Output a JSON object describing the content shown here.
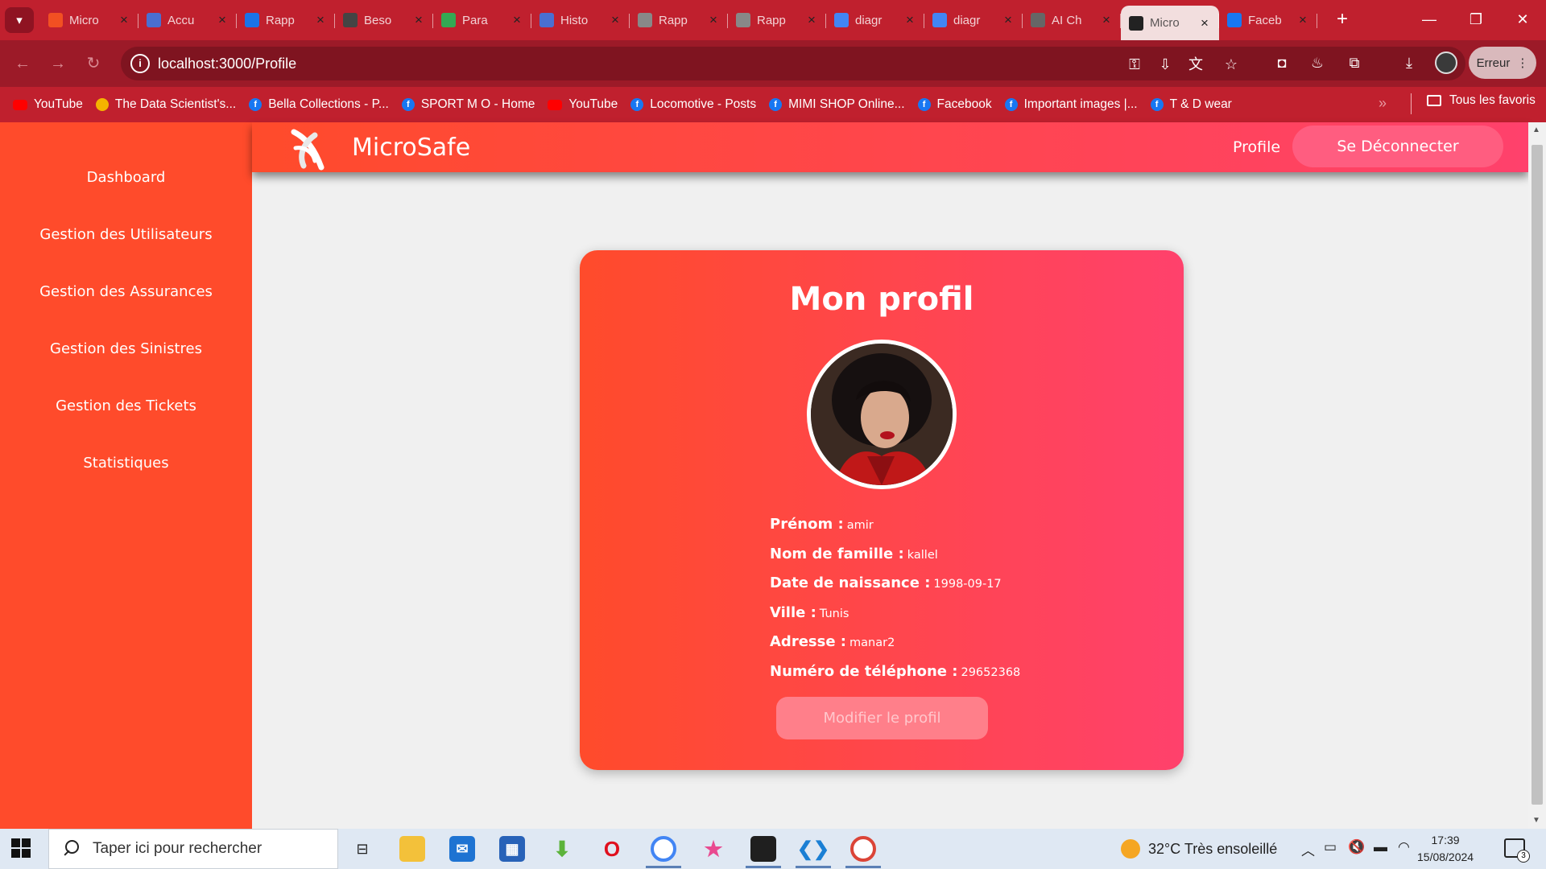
{
  "browser": {
    "tabs": [
      {
        "title": "Micro",
        "favicon": "microsoft-icon",
        "color": "#f25022",
        "active": false
      },
      {
        "title": "Accu",
        "favicon": "app-icon",
        "color": "#4a6fd1",
        "active": false
      },
      {
        "title": "Rapp",
        "favicon": "onedrive-icon",
        "color": "#1a73e8",
        "active": false
      },
      {
        "title": "Beso",
        "favicon": "openai-icon",
        "color": "#444444",
        "active": false
      },
      {
        "title": "Para",
        "favicon": "android-icon",
        "color": "#34a853",
        "active": false
      },
      {
        "title": "Histo",
        "favicon": "user-icon",
        "color": "#4a6fd1",
        "active": false
      },
      {
        "title": "Rapp",
        "favicon": "globe-icon",
        "color": "#888888",
        "active": false
      },
      {
        "title": "Rapp",
        "favicon": "globe-icon",
        "color": "#888888",
        "active": false
      },
      {
        "title": "diagr",
        "favicon": "google-icon",
        "color": "#4285f4",
        "active": false
      },
      {
        "title": "diagr",
        "favicon": "google-icon",
        "color": "#4285f4",
        "active": false
      },
      {
        "title": "AI Ch",
        "favicon": "ai-icon",
        "color": "#666666",
        "active": false
      },
      {
        "title": "Micro",
        "favicon": "react-icon",
        "color": "#222222",
        "active": true
      },
      {
        "title": "Faceb",
        "favicon": "facebook-icon",
        "color": "#1877f2",
        "active": false
      }
    ],
    "url": "localhost:3000/Profile",
    "profile_button": "Erreur",
    "bookmarks": [
      {
        "label": "YouTube",
        "icon": "youtube"
      },
      {
        "label": "The Data Scientist's...",
        "icon": "drive"
      },
      {
        "label": "Bella Collections - P...",
        "icon": "facebook"
      },
      {
        "label": "SPORT M O - Home",
        "icon": "facebook"
      },
      {
        "label": "YouTube",
        "icon": "youtube"
      },
      {
        "label": "Locomotive - Posts",
        "icon": "facebook"
      },
      {
        "label": "MIMI SHOP Online...",
        "icon": "facebook"
      },
      {
        "label": "Facebook",
        "icon": "facebook"
      },
      {
        "label": "Important images |...",
        "icon": "facebook"
      },
      {
        "label": "T & D wear",
        "icon": "facebook"
      }
    ],
    "bookmarks_overflow": "»",
    "all_bookmarks": "Tous les favoris"
  },
  "app": {
    "brand": "MicroSafe",
    "nav_profile": "Profile",
    "logout": "Se Déconnecter",
    "sidebar": [
      "Dashboard",
      "Gestion des Utilisateurs",
      "Gestion des Assurances",
      "Gestion des Sinistres",
      "Gestion des Tickets",
      "Statistiques"
    ],
    "profile": {
      "title": "Mon profil",
      "fields": [
        {
          "label": "Prénom :",
          "value": "amir"
        },
        {
          "label": "Nom de famille :",
          "value": "kallel"
        },
        {
          "label": "Date de naissance :",
          "value": "1998-09-17"
        },
        {
          "label": "Ville :",
          "value": "Tunis"
        },
        {
          "label": "Adresse :",
          "value": "manar2"
        },
        {
          "label": "Numéro de téléphone :",
          "value": "29652368"
        }
      ],
      "edit_button": "Modifier le profil"
    },
    "colors": {
      "accent": "#ff4b2b",
      "accent2": "#ff416c"
    }
  },
  "taskbar": {
    "search_placeholder": "Taper ici pour rechercher",
    "weather": "32°C  Très ensoleillé",
    "time": "17:39",
    "date": "15/08/2024",
    "notifications": "3"
  }
}
